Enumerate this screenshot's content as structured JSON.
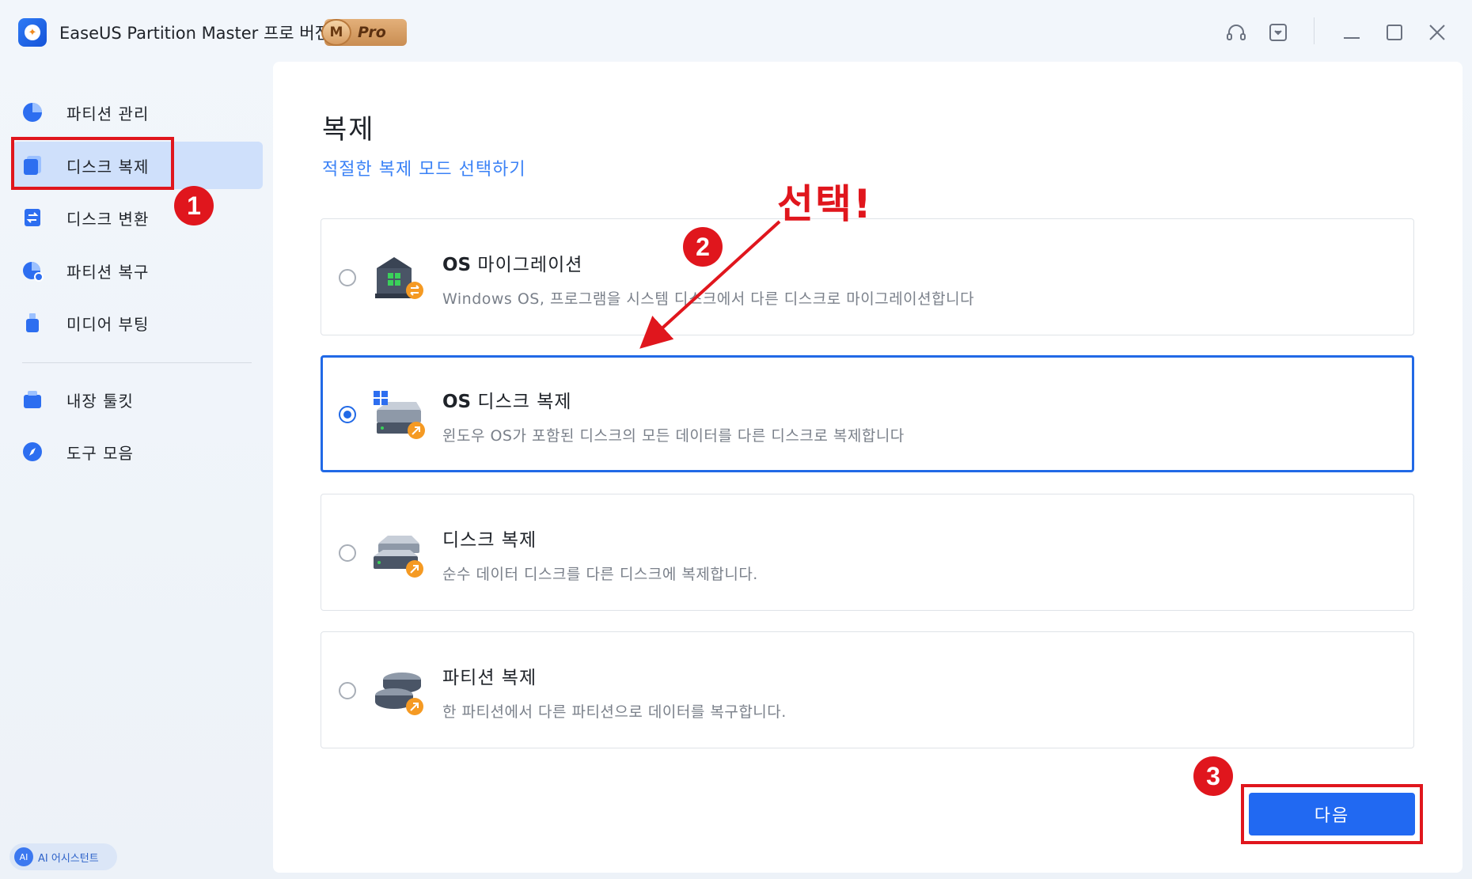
{
  "window": {
    "app_title": "EaseUS Partition Master 프로 버전",
    "badge_m": "M",
    "badge_pro": "Pro",
    "icons": [
      "headset-icon",
      "dropdown-box-icon",
      "minimize-icon",
      "maximize-icon",
      "close-icon"
    ]
  },
  "sidebar": {
    "items": [
      {
        "label": "파티션 관리",
        "icon": "pie-chart-icon"
      },
      {
        "label": "디스크 복제",
        "icon": "disk-clone-icon",
        "active": true
      },
      {
        "label": "디스크 변환",
        "icon": "disk-convert-icon"
      },
      {
        "label": "파티션 복구",
        "icon": "partition-recovery-icon"
      },
      {
        "label": "미디어 부팅",
        "icon": "usb-boot-icon"
      },
      {
        "label": "내장 툴킷",
        "icon": "toolkit-icon"
      },
      {
        "label": "도구 모음",
        "icon": "compass-icon"
      }
    ],
    "ai_assistant": "AI 어시스턴트",
    "ai_icon_text": "AI"
  },
  "main": {
    "title": "복제",
    "subtitle": "적절한 복제 모드 선택하기",
    "options": [
      {
        "title_bold": "OS",
        "title_rest": " 마이그레이션",
        "desc": "Windows OS, 프로그램을 시스템 디스크에서 다른 디스크로 마이그레이션합니다",
        "selected": false,
        "icon": "os-migration-icon"
      },
      {
        "title_bold": "OS",
        "title_rest": " 디스크 복제",
        "desc": "윈도우 OS가 포함된 디스크의 모든 데이터를 다른 디스크로 복제합니다",
        "selected": true,
        "icon": "os-disk-clone-icon"
      },
      {
        "title_bold": "",
        "title_rest": "디스크 복제",
        "desc": "순수 데이터 디스크를 다른 디스크에 복제합니다.",
        "selected": false,
        "icon": "disk-clone-option-icon"
      },
      {
        "title_bold": "",
        "title_rest": "파티션 복제",
        "desc": "한 파티션에서 다른 파티션으로 데이터를  복구합니다.",
        "selected": false,
        "icon": "partition-clone-icon"
      }
    ],
    "next_label": "다음"
  },
  "annotations": {
    "step1": "1",
    "step2": "2",
    "step3": "3",
    "callout": "선택!",
    "accent": "#e0161d"
  },
  "colors": {
    "primary": "#2169f2",
    "link": "#3b82f6",
    "sidebar_active": "#cfe0fb"
  }
}
